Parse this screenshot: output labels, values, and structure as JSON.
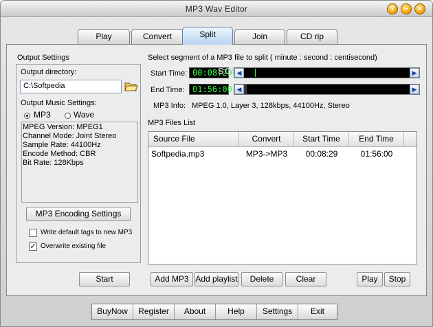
{
  "window": {
    "title": "MP3 Wav Editor"
  },
  "tabs": [
    "Play",
    "Convert",
    "Split",
    "Join",
    "CD rip"
  ],
  "output_settings": {
    "heading": "Output Settings",
    "directory_label": "Output directory:",
    "directory_value": "C:\\Softpedia",
    "music_settings_label": "Output Music Settings:",
    "radio_mp3": "MP3",
    "radio_wave": "Wave",
    "info_lines": [
      "MPEG Version: MPEG1",
      "Channel Mode: Joint Stereo",
      "Sample Rate: 44100Hz",
      "Encode Method: CBR",
      "Bit Rate: 128Kbps"
    ],
    "encoding_button": "MP3 Encoding Settings",
    "checkbox_tags": "Write default tags to new MP3",
    "checkbox_overwrite": "Overwrite existing file",
    "start_button": "Start"
  },
  "split": {
    "instruction": "Select segment of a MP3 file to split ( minute : second : centisecond)",
    "start_label": "Start Time:",
    "start_value": "00:08:29",
    "end_label": "End  Time:",
    "end_value": "01:56:00",
    "mp3_info_label": "MP3 Info:",
    "mp3_info_value": "MPEG 1.0,  Layer 3,  128kbps,  44100Hz,  Stereo",
    "watermark": "SOFTPEDIA"
  },
  "files": {
    "heading": "MP3 Files List",
    "columns": [
      "Source File",
      "Convert",
      "Start Time",
      "End Time"
    ],
    "rows": [
      {
        "source": "Softpedia.mp3",
        "convert": "MP3->MP3",
        "start": "00:08:29",
        "end": "01:56:00"
      }
    ]
  },
  "list_buttons": {
    "add_mp3": "Add MP3",
    "add_playlist": "Add playlist",
    "delete": "Delete",
    "clear": "Clear",
    "play": "Play",
    "stop": "Stop"
  },
  "bottom_buttons": [
    "BuyNow",
    "Register",
    "About",
    "Help",
    "Settings",
    "Exit"
  ],
  "colors": {
    "time_text": "#2cff3a",
    "active_tab": "#b8d4f0",
    "window_button": "#f2a200"
  }
}
